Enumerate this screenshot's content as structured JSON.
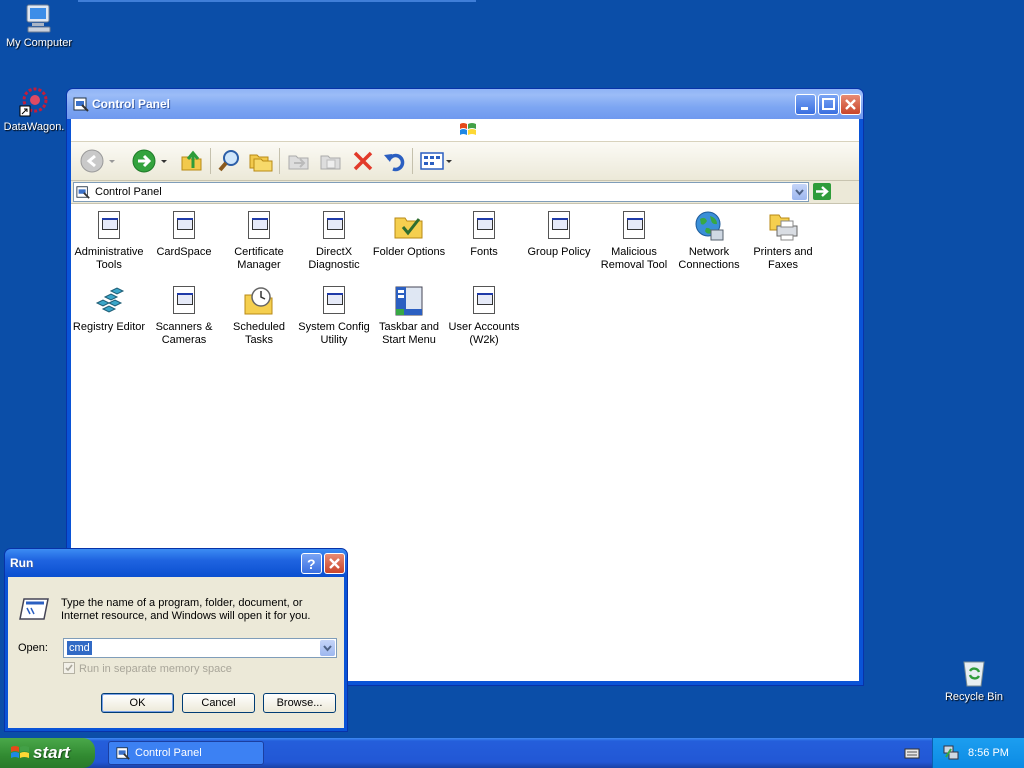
{
  "desktop": {
    "icons": [
      {
        "label": "My Computer",
        "icon": "my-computer-icon"
      },
      {
        "label": "DataWagon.",
        "icon": "datawagon-shortcut-icon"
      },
      {
        "label": "Recycle Bin",
        "icon": "recycle-bin-icon"
      }
    ]
  },
  "window": {
    "title": "Control Panel",
    "address": "Control Panel",
    "toolbar": [
      "back-icon",
      "forward-icon",
      "up-folder-icon",
      "search-icon",
      "folders-icon",
      "move-to-icon",
      "copy-to-icon",
      "delete-icon",
      "undo-icon",
      "views-icon"
    ],
    "items": [
      {
        "label": "Administrative Tools",
        "l1": "Administrative",
        "l2": "Tools"
      },
      {
        "label": "CardSpace",
        "l1": "CardSpace",
        "l2": ""
      },
      {
        "label": "Certificate Manager",
        "l1": "Certificate",
        "l2": "Manager"
      },
      {
        "label": "DirectX Diagnostic",
        "l1": "DirectX",
        "l2": "Diagnostic"
      },
      {
        "label": "Folder Options",
        "l1": "Folder Options",
        "l2": ""
      },
      {
        "label": "Fonts",
        "l1": "Fonts",
        "l2": ""
      },
      {
        "label": "Group Policy",
        "l1": "Group Policy",
        "l2": ""
      },
      {
        "label": "Malicious Removal Tool",
        "l1": "Malicious",
        "l2": "Removal Tool"
      },
      {
        "label": "Network Connections",
        "l1": "Network",
        "l2": "Connections"
      },
      {
        "label": "Printers and Faxes",
        "l1": "Printers and",
        "l2": "Faxes"
      },
      {
        "label": "Registry Editor",
        "l1": "Registry Editor",
        "l2": ""
      },
      {
        "label": "Scanners & Cameras",
        "l1": "Scanners &",
        "l2": "Cameras"
      },
      {
        "label": "Scheduled Tasks",
        "l1": "Scheduled",
        "l2": "Tasks"
      },
      {
        "label": "System Config Utility",
        "l1": "System Config",
        "l2": "Utility"
      },
      {
        "label": "Taskbar and Start Menu",
        "l1": "Taskbar and",
        "l2": "Start Menu"
      },
      {
        "label": "User Accounts (W2k)",
        "l1": "User Accounts",
        "l2": "(W2k)"
      }
    ]
  },
  "run": {
    "title": "Run",
    "description_line1": "Type the name of a program, folder, document, or",
    "description_line2": "Internet resource, and Windows will open it for you.",
    "open_label": "Open:",
    "open_value": "cmd",
    "checkbox_label": "Run in separate memory space",
    "ok": "OK",
    "cancel": "Cancel",
    "browse": "Browse..."
  },
  "taskbar": {
    "start": "start",
    "task": "Control Panel",
    "clock": "8:56 PM"
  }
}
